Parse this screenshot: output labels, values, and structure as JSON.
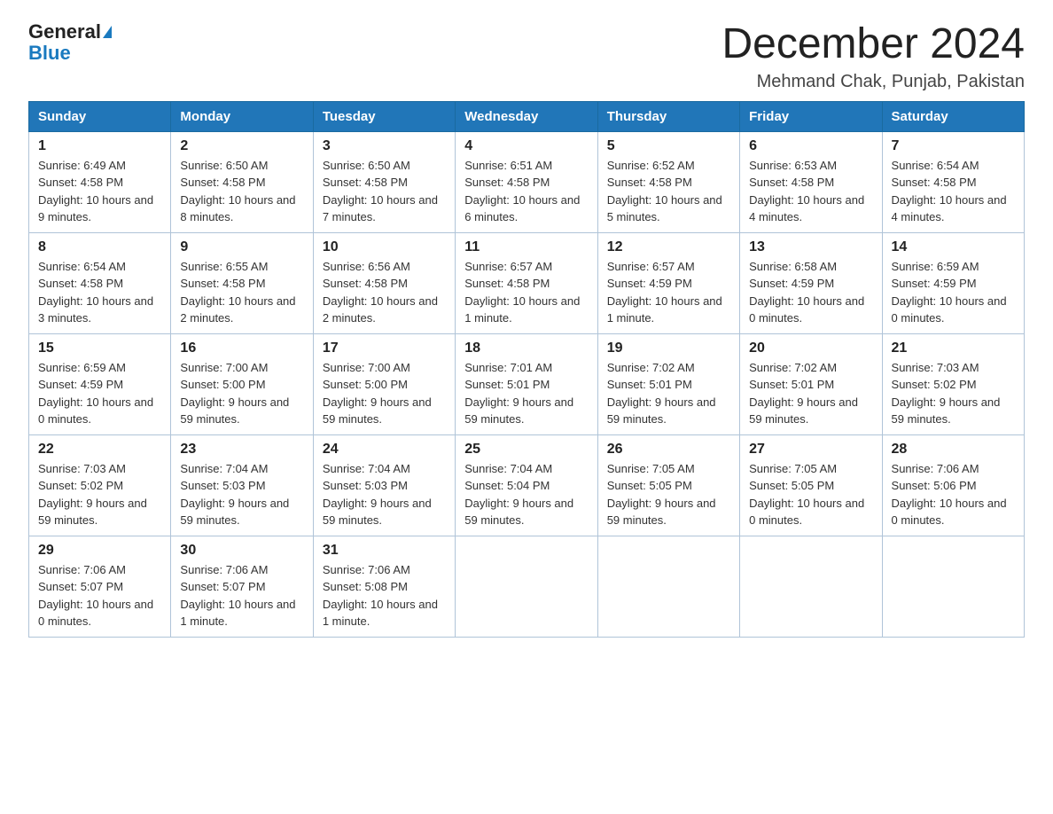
{
  "header": {
    "logo_general": "General",
    "logo_blue": "Blue",
    "month_title": "December 2024",
    "location": "Mehmand Chak, Punjab, Pakistan"
  },
  "days_of_week": [
    "Sunday",
    "Monday",
    "Tuesday",
    "Wednesday",
    "Thursday",
    "Friday",
    "Saturday"
  ],
  "weeks": [
    [
      {
        "day": "1",
        "sunrise": "6:49 AM",
        "sunset": "4:58 PM",
        "daylight": "10 hours and 9 minutes."
      },
      {
        "day": "2",
        "sunrise": "6:50 AM",
        "sunset": "4:58 PM",
        "daylight": "10 hours and 8 minutes."
      },
      {
        "day": "3",
        "sunrise": "6:50 AM",
        "sunset": "4:58 PM",
        "daylight": "10 hours and 7 minutes."
      },
      {
        "day": "4",
        "sunrise": "6:51 AM",
        "sunset": "4:58 PM",
        "daylight": "10 hours and 6 minutes."
      },
      {
        "day": "5",
        "sunrise": "6:52 AM",
        "sunset": "4:58 PM",
        "daylight": "10 hours and 5 minutes."
      },
      {
        "day": "6",
        "sunrise": "6:53 AM",
        "sunset": "4:58 PM",
        "daylight": "10 hours and 4 minutes."
      },
      {
        "day": "7",
        "sunrise": "6:54 AM",
        "sunset": "4:58 PM",
        "daylight": "10 hours and 4 minutes."
      }
    ],
    [
      {
        "day": "8",
        "sunrise": "6:54 AM",
        "sunset": "4:58 PM",
        "daylight": "10 hours and 3 minutes."
      },
      {
        "day": "9",
        "sunrise": "6:55 AM",
        "sunset": "4:58 PM",
        "daylight": "10 hours and 2 minutes."
      },
      {
        "day": "10",
        "sunrise": "6:56 AM",
        "sunset": "4:58 PM",
        "daylight": "10 hours and 2 minutes."
      },
      {
        "day": "11",
        "sunrise": "6:57 AM",
        "sunset": "4:58 PM",
        "daylight": "10 hours and 1 minute."
      },
      {
        "day": "12",
        "sunrise": "6:57 AM",
        "sunset": "4:59 PM",
        "daylight": "10 hours and 1 minute."
      },
      {
        "day": "13",
        "sunrise": "6:58 AM",
        "sunset": "4:59 PM",
        "daylight": "10 hours and 0 minutes."
      },
      {
        "day": "14",
        "sunrise": "6:59 AM",
        "sunset": "4:59 PM",
        "daylight": "10 hours and 0 minutes."
      }
    ],
    [
      {
        "day": "15",
        "sunrise": "6:59 AM",
        "sunset": "4:59 PM",
        "daylight": "10 hours and 0 minutes."
      },
      {
        "day": "16",
        "sunrise": "7:00 AM",
        "sunset": "5:00 PM",
        "daylight": "9 hours and 59 minutes."
      },
      {
        "day": "17",
        "sunrise": "7:00 AM",
        "sunset": "5:00 PM",
        "daylight": "9 hours and 59 minutes."
      },
      {
        "day": "18",
        "sunrise": "7:01 AM",
        "sunset": "5:01 PM",
        "daylight": "9 hours and 59 minutes."
      },
      {
        "day": "19",
        "sunrise": "7:02 AM",
        "sunset": "5:01 PM",
        "daylight": "9 hours and 59 minutes."
      },
      {
        "day": "20",
        "sunrise": "7:02 AM",
        "sunset": "5:01 PM",
        "daylight": "9 hours and 59 minutes."
      },
      {
        "day": "21",
        "sunrise": "7:03 AM",
        "sunset": "5:02 PM",
        "daylight": "9 hours and 59 minutes."
      }
    ],
    [
      {
        "day": "22",
        "sunrise": "7:03 AM",
        "sunset": "5:02 PM",
        "daylight": "9 hours and 59 minutes."
      },
      {
        "day": "23",
        "sunrise": "7:04 AM",
        "sunset": "5:03 PM",
        "daylight": "9 hours and 59 minutes."
      },
      {
        "day": "24",
        "sunrise": "7:04 AM",
        "sunset": "5:03 PM",
        "daylight": "9 hours and 59 minutes."
      },
      {
        "day": "25",
        "sunrise": "7:04 AM",
        "sunset": "5:04 PM",
        "daylight": "9 hours and 59 minutes."
      },
      {
        "day": "26",
        "sunrise": "7:05 AM",
        "sunset": "5:05 PM",
        "daylight": "9 hours and 59 minutes."
      },
      {
        "day": "27",
        "sunrise": "7:05 AM",
        "sunset": "5:05 PM",
        "daylight": "10 hours and 0 minutes."
      },
      {
        "day": "28",
        "sunrise": "7:06 AM",
        "sunset": "5:06 PM",
        "daylight": "10 hours and 0 minutes."
      }
    ],
    [
      {
        "day": "29",
        "sunrise": "7:06 AM",
        "sunset": "5:07 PM",
        "daylight": "10 hours and 0 minutes."
      },
      {
        "day": "30",
        "sunrise": "7:06 AM",
        "sunset": "5:07 PM",
        "daylight": "10 hours and 1 minute."
      },
      {
        "day": "31",
        "sunrise": "7:06 AM",
        "sunset": "5:08 PM",
        "daylight": "10 hours and 1 minute."
      },
      null,
      null,
      null,
      null
    ]
  ],
  "labels": {
    "sunrise": "Sunrise:",
    "sunset": "Sunset:",
    "daylight": "Daylight:"
  }
}
